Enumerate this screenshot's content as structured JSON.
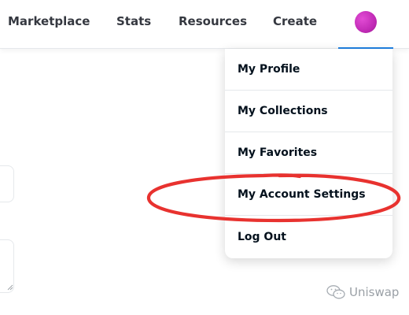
{
  "nav": {
    "links": [
      "Marketplace",
      "Stats",
      "Resources",
      "Create"
    ],
    "avatar_color": "#c12bb6",
    "active_color": "#2081e2"
  },
  "dropdown": {
    "items": [
      "My Profile",
      "My Collections",
      "My Favorites",
      "My Account Settings",
      "Log Out"
    ],
    "highlighted_item": "My Account Settings",
    "highlight_color": "#e8322f"
  },
  "watermark": {
    "text": "Uniswap",
    "icon": "wechat-icon"
  }
}
